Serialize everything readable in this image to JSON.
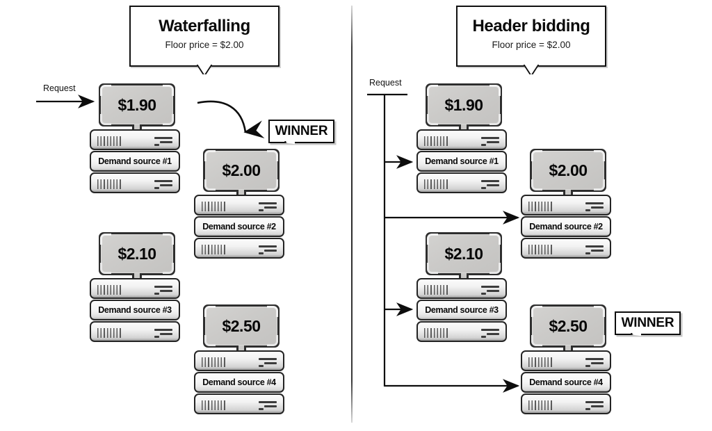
{
  "diagram": {
    "title_left": "Waterfalling",
    "title_right": "Header bidding",
    "subtitle_left": "Floor price = $2.00",
    "subtitle_right": "Floor price = $2.00",
    "request_label_left": "Request",
    "request_label_right": "Request",
    "winner_label_left": "WINNER",
    "winner_label_right": "WINNER",
    "floor_price": "$2.00",
    "colors": {
      "stroke": "#101010",
      "screen_fill": "#cbcac8",
      "rack_fill": "#f2f2f2",
      "background": "#ffffff"
    }
  },
  "left_panel": {
    "nodes": [
      {
        "bid": "$1.90",
        "source": "Demand source #1",
        "winner": false
      },
      {
        "bid": "$2.00",
        "source": "Demand source #2",
        "winner": true
      },
      {
        "bid": "$2.10",
        "source": "Demand source #3",
        "winner": false
      },
      {
        "bid": "$2.50",
        "source": "Demand source #4",
        "winner": false
      }
    ]
  },
  "right_panel": {
    "nodes": [
      {
        "bid": "$1.90",
        "source": "Demand source #1",
        "winner": false
      },
      {
        "bid": "$2.00",
        "source": "Demand source #2",
        "winner": false
      },
      {
        "bid": "$2.10",
        "source": "Demand source #3",
        "winner": false
      },
      {
        "bid": "$2.50",
        "source": "Demand source #4",
        "winner": true
      }
    ]
  }
}
